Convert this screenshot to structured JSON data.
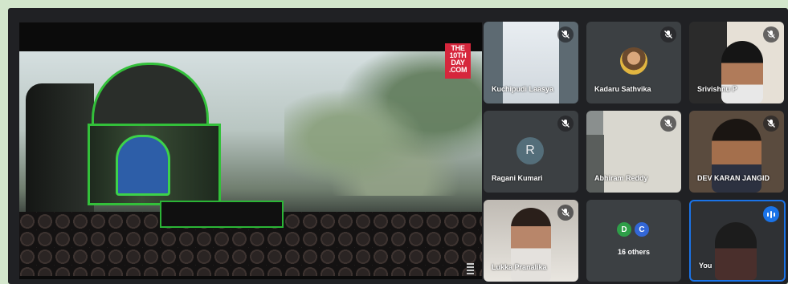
{
  "presentation": {
    "logo_lines": [
      "THE",
      "10TH",
      "DAY",
      ".COM"
    ]
  },
  "participants": [
    {
      "name": "Kuchipudi Laasya",
      "muted": true
    },
    {
      "name": "Kadaru Sathvika",
      "muted": true
    },
    {
      "name": "Srivishnu P",
      "muted": true
    },
    {
      "name": "Ragani Kumari",
      "muted": true,
      "initial": "R"
    },
    {
      "name": "Abhiram Reddy",
      "muted": true
    },
    {
      "name": "DEV KARAN JANGID",
      "muted": true
    },
    {
      "name": "Lukka Pranalika",
      "muted": true
    },
    {
      "label": "16 others",
      "initials": [
        "D",
        "C"
      ]
    },
    {
      "name": "You",
      "speaking": true
    }
  ],
  "colors": {
    "meet_bg": "#202124",
    "tile_bg": "#3c4043",
    "speaking_border": "#1a73e8",
    "avatar_d": "#2e9e48",
    "avatar_c": "#3367d6",
    "avatar_r": "#546e7a"
  }
}
